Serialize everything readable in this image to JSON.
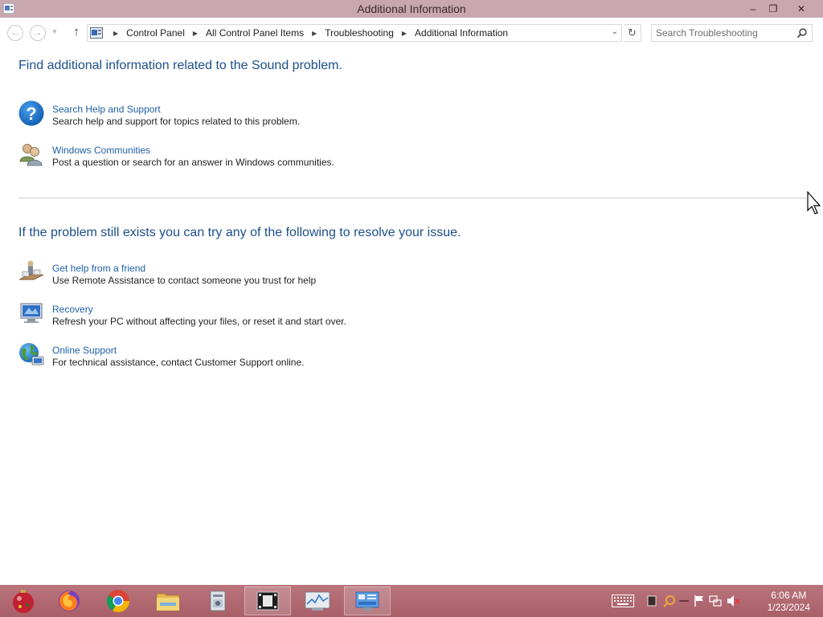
{
  "window": {
    "title": "Additional Information",
    "controls": {
      "minimize": "–",
      "maximize": "❐",
      "close": "✕"
    }
  },
  "address": {
    "breadcrumbs": [
      "Control Panel",
      "All Control Panel Items",
      "Troubleshooting",
      "Additional Information"
    ],
    "search_placeholder": "Search Troubleshooting"
  },
  "sections": {
    "additional_info_heading": "Find additional information related to the Sound problem.",
    "resolve_heading": "If the problem still exists you can try any of the following to resolve your issue."
  },
  "additional_items": [
    {
      "icon": "help-question-icon",
      "link": "Search Help and Support",
      "desc": "Search help and support for topics related to this problem."
    },
    {
      "icon": "windows-communities-icon",
      "link": "Windows Communities",
      "desc": "Post a question or search for an answer in Windows communities."
    }
  ],
  "resolve_items": [
    {
      "icon": "remote-assistance-icon",
      "link": "Get help from a friend",
      "desc": "Use Remote Assistance to contact someone you trust for help"
    },
    {
      "icon": "recovery-icon",
      "link": "Recovery",
      "desc": "Refresh your PC without affecting your files, or reset it and start over."
    },
    {
      "icon": "online-support-globe-icon",
      "link": "Online Support",
      "desc": "For technical assistance, contact Customer Support online."
    }
  ],
  "taskbar": {
    "apps": [
      "christmas-ornament-icon",
      "firefox-icon",
      "chrome-icon",
      "file-explorer-icon",
      "installer-icon",
      "media-player-icon",
      "performance-monitor-icon",
      "control-panel-icon"
    ],
    "active_app": "control-panel-icon"
  },
  "tray": {
    "time": "6:06 AM",
    "date": "1/23/2024"
  },
  "colors": {
    "titlebar": "#c9a7ae",
    "taskbar": "#b06a72",
    "link": "#1f5fa7",
    "heading": "#1c4f8b"
  }
}
